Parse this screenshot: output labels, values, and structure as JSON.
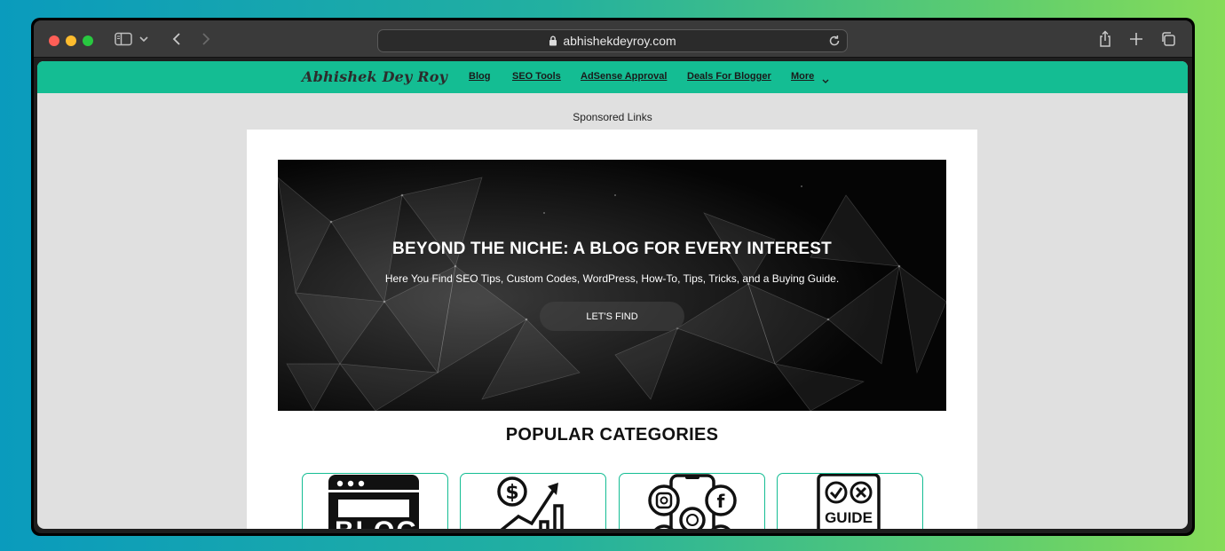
{
  "browser": {
    "url": "abhishekdeyroy.com",
    "icons": [
      "sidebar-icon",
      "chevron-down-icon",
      "back-icon",
      "forward-icon",
      "lock-icon",
      "reload-icon",
      "share-icon",
      "new-tab-icon",
      "tab-overview-icon"
    ]
  },
  "site": {
    "brand": "Abhishek Dey Roy",
    "nav": [
      {
        "label": "Blog"
      },
      {
        "label": "SEO Tools"
      },
      {
        "label": "AdSense Approval"
      },
      {
        "label": "Deals For Blogger"
      },
      {
        "label": "More"
      }
    ],
    "sponsored": "Sponsored Links",
    "hero": {
      "title": "BEYOND THE NICHE: A BLOG FOR EVERY INTEREST",
      "subtitle": "Here You Find SEO Tips, Custom Codes, WordPress, How-To, Tips, Tricks, and a Buying Guide.",
      "button": "LET'S FIND"
    },
    "categories_heading": "POPULAR CATEGORIES",
    "categories": [
      {
        "icon": "blog-icon",
        "icon_text": "BLOG"
      },
      {
        "icon": "seo-growth-icon"
      },
      {
        "icon": "social-media-icon"
      },
      {
        "icon": "guide-icon",
        "icon_text": "GUIDE"
      }
    ]
  },
  "colors": {
    "nav_bg": "#14bd93",
    "page_bg": "#e0e0e0",
    "hero_bg": "#050505",
    "card_border": "#14bd93"
  }
}
